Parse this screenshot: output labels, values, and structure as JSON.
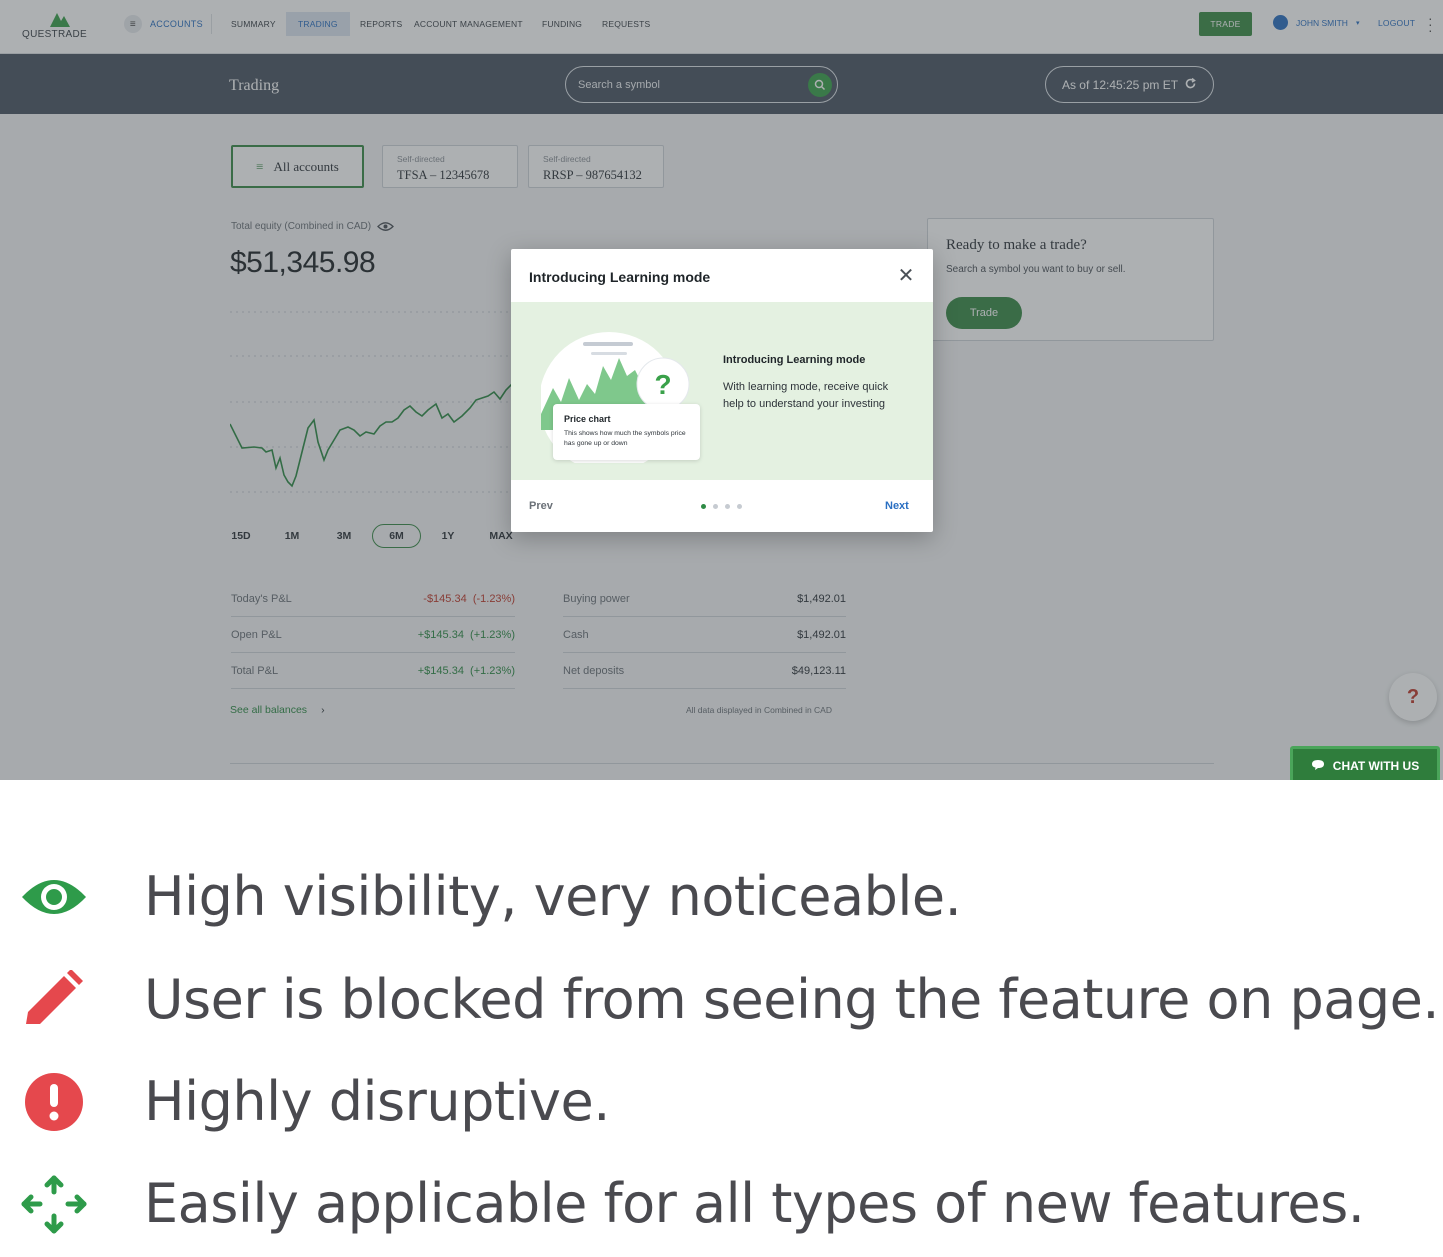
{
  "nav": {
    "logo_text": "QUESTRADE",
    "accounts": "ACCOUNTS",
    "items": [
      "SUMMARY",
      "TRADING",
      "REPORTS",
      "ACCOUNT MANAGEMENT",
      "FUNDING",
      "REQUESTS"
    ],
    "active_item": "TRADING",
    "trade_button": "TRADE",
    "user": "JOHN SMITH",
    "logout": "LOGOUT"
  },
  "header": {
    "title": "Trading",
    "search_placeholder": "Search a symbol",
    "as_of": "As of 12:45:25 pm ET"
  },
  "accounts": {
    "all": "All accounts",
    "tfsa": {
      "type": "Self-directed",
      "name": "TFSA – 12345678"
    },
    "rrsp": {
      "type": "Self-directed",
      "name": "RRSP – 987654132"
    }
  },
  "equity": {
    "label": "Total equity (Combined in CAD)",
    "value": "$51,345.98"
  },
  "chart_ranges": [
    "15D",
    "1M",
    "3M",
    "6M",
    "1Y",
    "MAX"
  ],
  "selected_range": "6M",
  "pl": [
    {
      "label": "Today's P&L",
      "value": "-$145.34  (-1.23%)",
      "tone": "neg"
    },
    {
      "label": "Open P&L",
      "value": "+$145.34  (+1.23%)",
      "tone": "pos"
    },
    {
      "label": "Total P&L",
      "value": "+$145.34  (+1.23%)",
      "tone": "pos"
    }
  ],
  "balances": [
    {
      "label": "Buying power",
      "value": "$1,492.01"
    },
    {
      "label": "Cash",
      "value": "$1,492.01"
    },
    {
      "label": "Net deposits",
      "value": "$49,123.11"
    }
  ],
  "see_all": "See all balances",
  "footnote": "All data displayed in Combined in CAD",
  "trade_card": {
    "title": "Ready to make a trade?",
    "subtitle": "Search a symbol you want to buy or sell.",
    "button": "Trade"
  },
  "help_fab": "?",
  "chat": "CHAT WITH US",
  "modal": {
    "title": "Introducing Learning mode",
    "body_title": "Introducing Learning mode",
    "body_text": "With learning mode, receive quick help to understand your investing",
    "card_title": "Price chart",
    "card_text": "This shows how much the symbols price has gone up or down",
    "question_mark": "?",
    "prev": "Prev",
    "next": "Next",
    "step": 1,
    "steps": 4
  },
  "bullets": [
    {
      "icon": "eye-icon",
      "color": "#2e9b4a",
      "text": "High visibility, very noticeable."
    },
    {
      "icon": "pencil-icon",
      "color": "#e5484d",
      "text": "User is blocked from seeing the feature on page."
    },
    {
      "icon": "exclamation-icon",
      "color": "#e5484d",
      "text": "Highly disruptive."
    },
    {
      "icon": "move-arrows-icon",
      "color": "#2e9b4a",
      "text": "Easily applicable for all types of new features."
    }
  ],
  "colors": {
    "brand_green": "#3a8a48",
    "link_blue": "#2a6fc2",
    "header_dark": "#4a5563",
    "negative": "#c0392b"
  }
}
